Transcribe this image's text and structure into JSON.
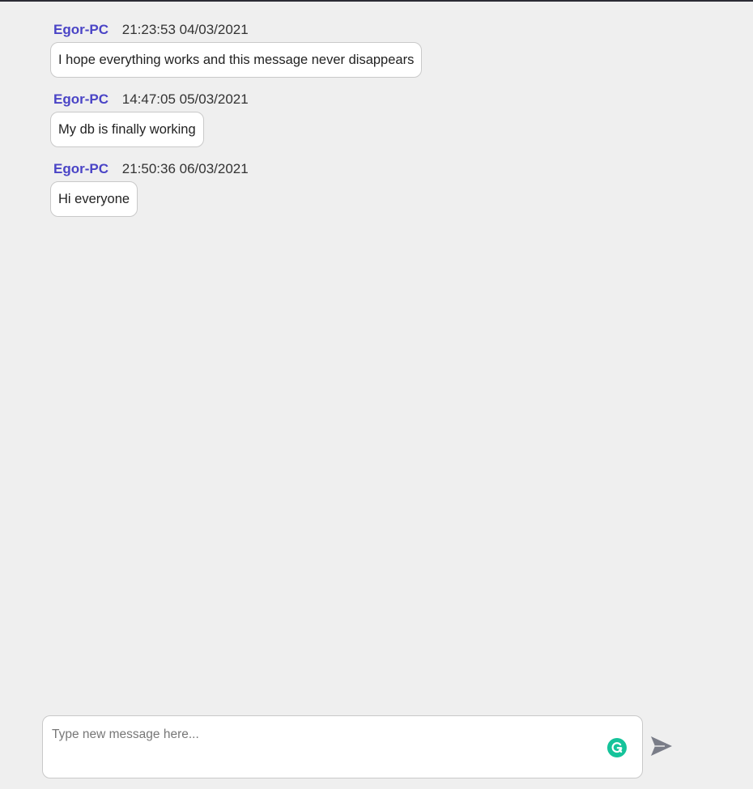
{
  "messages": [
    {
      "author": "Egor-PC",
      "timestamp": "21:23:53 04/03/2021",
      "text": "I hope everything works and this message never disappears"
    },
    {
      "author": "Egor-PC",
      "timestamp": "14:47:05 05/03/2021",
      "text": "My db is finally working"
    },
    {
      "author": "Egor-PC",
      "timestamp": "21:50:36 06/03/2021",
      "text": "Hi everyone"
    }
  ],
  "composer": {
    "placeholder": "Type new message here...",
    "value": ""
  },
  "icons": {
    "grammarly": "grammarly-icon",
    "send": "send-icon"
  },
  "colors": {
    "author": "#4a44c6",
    "background": "#efefef",
    "grammarly": "#15c39a",
    "send": "#7a7d88"
  }
}
